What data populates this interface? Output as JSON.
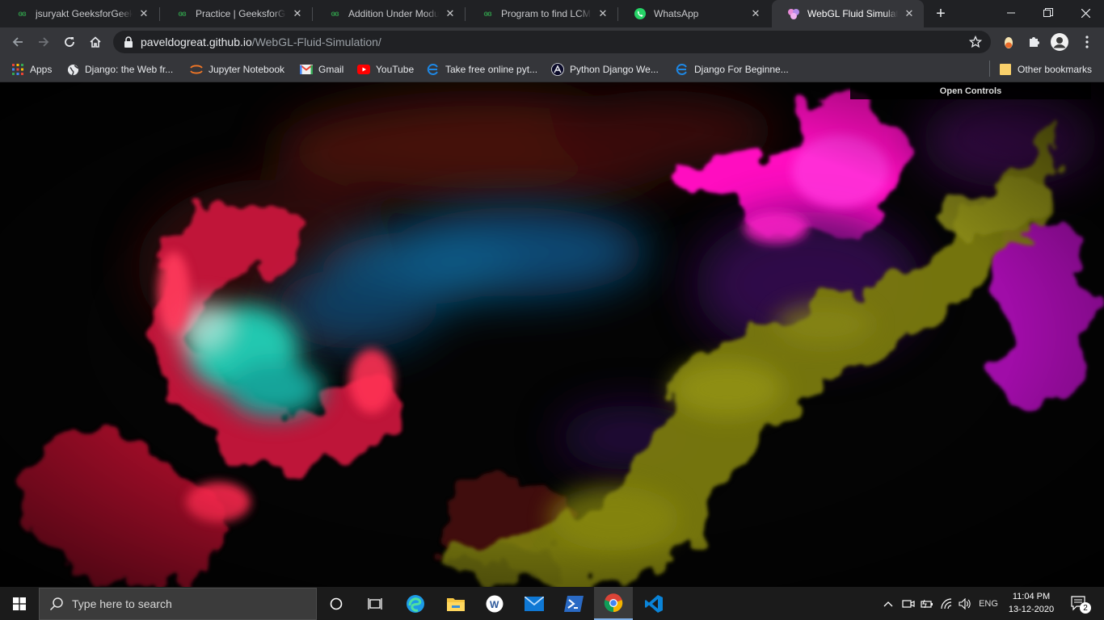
{
  "browser": {
    "tabs": [
      {
        "title": "jsuryakt GeeksforGeeks",
        "favicon": "geeksforgeeks-icon"
      },
      {
        "title": "Practice | GeeksforGeeks",
        "favicon": "geeksforgeeks-icon"
      },
      {
        "title": "Addition Under Modulo",
        "favicon": "geeksforgeeks-icon"
      },
      {
        "title": "Program to find LCM of two numbers",
        "favicon": "geeksforgeeks-icon"
      },
      {
        "title": "WhatsApp",
        "favicon": "whatsapp-icon"
      },
      {
        "title": "WebGL Fluid Simulation",
        "favicon": "webgl-fluid-icon",
        "active": true
      }
    ],
    "new_tab_label": "+",
    "window_controls": {
      "minimize": "—",
      "maximize": "❐",
      "close": "✕"
    },
    "address": {
      "host": "paveldogreat.github.io",
      "path": "/WebGL-Fluid-Simulation/"
    },
    "bookmarks": [
      {
        "label": "Apps",
        "icon": "apps-grid-icon"
      },
      {
        "label": "Django: the Web fr...",
        "icon": "globe-icon"
      },
      {
        "label": "Jupyter Notebook",
        "icon": "jupyter-icon"
      },
      {
        "label": "Gmail",
        "icon": "gmail-icon"
      },
      {
        "label": "YouTube",
        "icon": "youtube-icon"
      },
      {
        "label": "Take free online pyt...",
        "icon": "edx-icon"
      },
      {
        "label": "Python Django We...",
        "icon": "django-course-icon"
      },
      {
        "label": "Django For Beginne...",
        "icon": "edx-icon"
      }
    ],
    "other_bookmarks": "Other bookmarks"
  },
  "page": {
    "open_controls_label": "Open Controls"
  },
  "taskbar": {
    "search_placeholder": "Type here to search",
    "apps": [
      "cortana-icon",
      "task-view-icon",
      "edge-icon",
      "file-explorer-icon",
      "word-icon",
      "mail-icon",
      "powershell-icon",
      "chrome-icon",
      "vscode-icon"
    ],
    "tray": {
      "language": "ENG"
    },
    "clock": {
      "time": "11:04 PM",
      "date": "13-12-2020"
    },
    "notifications_count": "2"
  },
  "colors": {
    "tabstrip_bg": "#202124",
    "toolbar_bg": "#35363a",
    "omnibox_bg": "#202124",
    "taskbar_bg": "#1b1b1b",
    "fluid_red": "#e8194a",
    "fluid_cyan": "#27e0c0",
    "fluid_blue": "#0a5a8a",
    "fluid_magenta": "#ff18c8",
    "fluid_olive": "#8a8a10",
    "fluid_purple": "#5a1a8a"
  }
}
